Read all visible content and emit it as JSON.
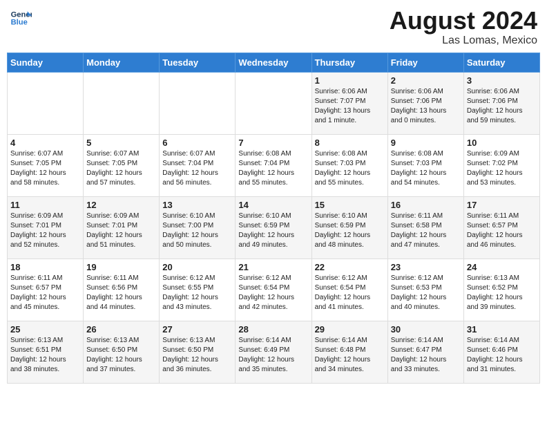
{
  "header": {
    "logo_line1": "General",
    "logo_line2": "Blue",
    "title": "August 2024",
    "subtitle": "Las Lomas, Mexico"
  },
  "days_of_week": [
    "Sunday",
    "Monday",
    "Tuesday",
    "Wednesday",
    "Thursday",
    "Friday",
    "Saturday"
  ],
  "weeks": [
    [
      {
        "day": "",
        "content": ""
      },
      {
        "day": "",
        "content": ""
      },
      {
        "day": "",
        "content": ""
      },
      {
        "day": "",
        "content": ""
      },
      {
        "day": "1",
        "content": "Sunrise: 6:06 AM\nSunset: 7:07 PM\nDaylight: 13 hours\nand 1 minute."
      },
      {
        "day": "2",
        "content": "Sunrise: 6:06 AM\nSunset: 7:06 PM\nDaylight: 13 hours\nand 0 minutes."
      },
      {
        "day": "3",
        "content": "Sunrise: 6:06 AM\nSunset: 7:06 PM\nDaylight: 12 hours\nand 59 minutes."
      }
    ],
    [
      {
        "day": "4",
        "content": "Sunrise: 6:07 AM\nSunset: 7:05 PM\nDaylight: 12 hours\nand 58 minutes."
      },
      {
        "day": "5",
        "content": "Sunrise: 6:07 AM\nSunset: 7:05 PM\nDaylight: 12 hours\nand 57 minutes."
      },
      {
        "day": "6",
        "content": "Sunrise: 6:07 AM\nSunset: 7:04 PM\nDaylight: 12 hours\nand 56 minutes."
      },
      {
        "day": "7",
        "content": "Sunrise: 6:08 AM\nSunset: 7:04 PM\nDaylight: 12 hours\nand 55 minutes."
      },
      {
        "day": "8",
        "content": "Sunrise: 6:08 AM\nSunset: 7:03 PM\nDaylight: 12 hours\nand 55 minutes."
      },
      {
        "day": "9",
        "content": "Sunrise: 6:08 AM\nSunset: 7:03 PM\nDaylight: 12 hours\nand 54 minutes."
      },
      {
        "day": "10",
        "content": "Sunrise: 6:09 AM\nSunset: 7:02 PM\nDaylight: 12 hours\nand 53 minutes."
      }
    ],
    [
      {
        "day": "11",
        "content": "Sunrise: 6:09 AM\nSunset: 7:01 PM\nDaylight: 12 hours\nand 52 minutes."
      },
      {
        "day": "12",
        "content": "Sunrise: 6:09 AM\nSunset: 7:01 PM\nDaylight: 12 hours\nand 51 minutes."
      },
      {
        "day": "13",
        "content": "Sunrise: 6:10 AM\nSunset: 7:00 PM\nDaylight: 12 hours\nand 50 minutes."
      },
      {
        "day": "14",
        "content": "Sunrise: 6:10 AM\nSunset: 6:59 PM\nDaylight: 12 hours\nand 49 minutes."
      },
      {
        "day": "15",
        "content": "Sunrise: 6:10 AM\nSunset: 6:59 PM\nDaylight: 12 hours\nand 48 minutes."
      },
      {
        "day": "16",
        "content": "Sunrise: 6:11 AM\nSunset: 6:58 PM\nDaylight: 12 hours\nand 47 minutes."
      },
      {
        "day": "17",
        "content": "Sunrise: 6:11 AM\nSunset: 6:57 PM\nDaylight: 12 hours\nand 46 minutes."
      }
    ],
    [
      {
        "day": "18",
        "content": "Sunrise: 6:11 AM\nSunset: 6:57 PM\nDaylight: 12 hours\nand 45 minutes."
      },
      {
        "day": "19",
        "content": "Sunrise: 6:11 AM\nSunset: 6:56 PM\nDaylight: 12 hours\nand 44 minutes."
      },
      {
        "day": "20",
        "content": "Sunrise: 6:12 AM\nSunset: 6:55 PM\nDaylight: 12 hours\nand 43 minutes."
      },
      {
        "day": "21",
        "content": "Sunrise: 6:12 AM\nSunset: 6:54 PM\nDaylight: 12 hours\nand 42 minutes."
      },
      {
        "day": "22",
        "content": "Sunrise: 6:12 AM\nSunset: 6:54 PM\nDaylight: 12 hours\nand 41 minutes."
      },
      {
        "day": "23",
        "content": "Sunrise: 6:12 AM\nSunset: 6:53 PM\nDaylight: 12 hours\nand 40 minutes."
      },
      {
        "day": "24",
        "content": "Sunrise: 6:13 AM\nSunset: 6:52 PM\nDaylight: 12 hours\nand 39 minutes."
      }
    ],
    [
      {
        "day": "25",
        "content": "Sunrise: 6:13 AM\nSunset: 6:51 PM\nDaylight: 12 hours\nand 38 minutes."
      },
      {
        "day": "26",
        "content": "Sunrise: 6:13 AM\nSunset: 6:50 PM\nDaylight: 12 hours\nand 37 minutes."
      },
      {
        "day": "27",
        "content": "Sunrise: 6:13 AM\nSunset: 6:50 PM\nDaylight: 12 hours\nand 36 minutes."
      },
      {
        "day": "28",
        "content": "Sunrise: 6:14 AM\nSunset: 6:49 PM\nDaylight: 12 hours\nand 35 minutes."
      },
      {
        "day": "29",
        "content": "Sunrise: 6:14 AM\nSunset: 6:48 PM\nDaylight: 12 hours\nand 34 minutes."
      },
      {
        "day": "30",
        "content": "Sunrise: 6:14 AM\nSunset: 6:47 PM\nDaylight: 12 hours\nand 33 minutes."
      },
      {
        "day": "31",
        "content": "Sunrise: 6:14 AM\nSunset: 6:46 PM\nDaylight: 12 hours\nand 31 minutes."
      }
    ]
  ]
}
